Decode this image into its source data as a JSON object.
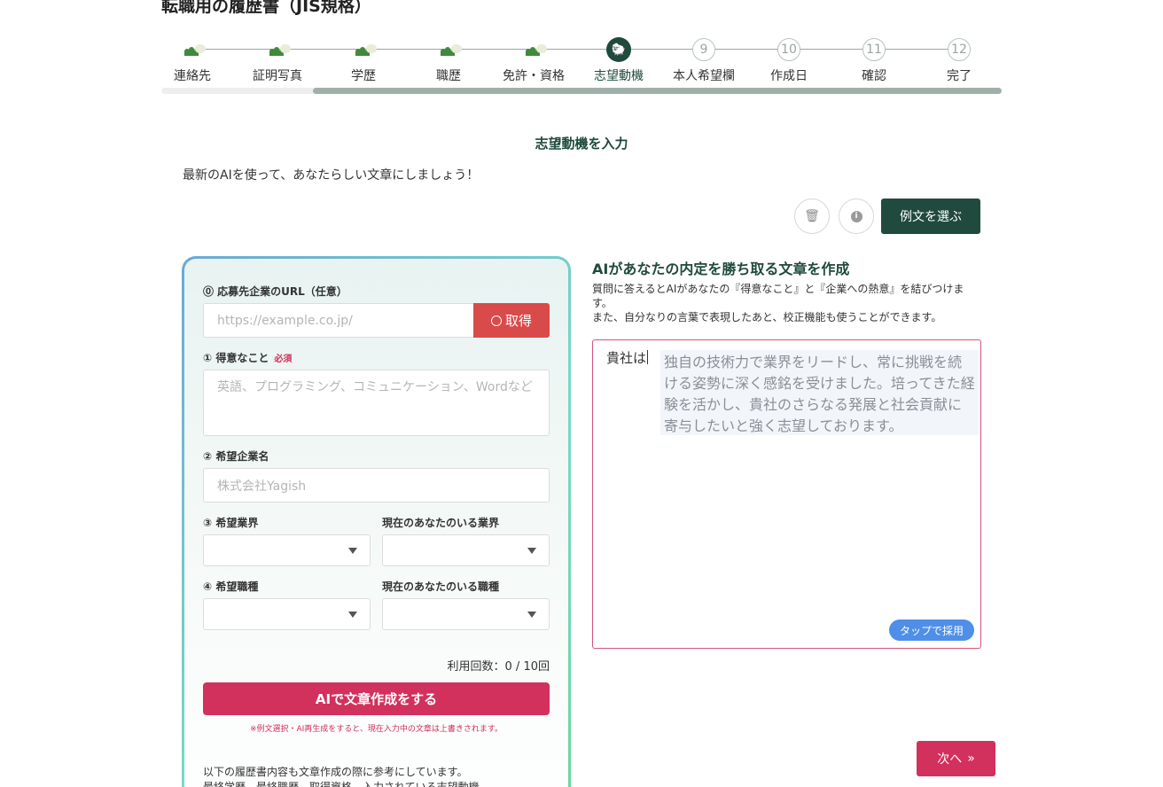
{
  "page": {
    "title": "転職用の履歴書（JIS規格）"
  },
  "stepper": {
    "progress_percent": 18,
    "steps": [
      {
        "label": "連絡先",
        "state": "done"
      },
      {
        "label": "証明写真",
        "state": "done"
      },
      {
        "label": "学歴",
        "state": "done"
      },
      {
        "label": "職歴",
        "state": "done"
      },
      {
        "label": "免許・資格",
        "state": "done"
      },
      {
        "label": "志望動機",
        "state": "active"
      },
      {
        "label": "本人希望欄",
        "state": "pending",
        "number": "9"
      },
      {
        "label": "作成日",
        "state": "pending",
        "number": "10"
      },
      {
        "label": "確認",
        "state": "pending",
        "number": "11"
      },
      {
        "label": "完了",
        "state": "pending",
        "number": "12"
      }
    ]
  },
  "section": {
    "heading": "志望動機を入力",
    "lead": "最新のAIを使って、あなたらしい文章にしましょう！"
  },
  "toolbar": {
    "example_label": "例文を選ぶ",
    "trash_icon": "trash-icon",
    "info_icon": "info-icon"
  },
  "form": {
    "url_label": "⓪ 応募先企業のURL（任意）",
    "url_placeholder": "https://example.co.jp/",
    "fetch_label": "取得",
    "strength_label": "① 得意なこと",
    "required_badge": "必須",
    "strength_placeholder": "英語、プログラミング、コミュニケーション、Wordなど",
    "company_label": "② 希望企業名",
    "company_placeholder": "株式会社Yagish",
    "industry_label": "③ 希望業界",
    "current_industry_label": "現在のあなたのいる業界",
    "job_label": "④ 希望職種",
    "current_job_label": "現在のあなたのいる職種",
    "usage": "利用回数：0 / 10回",
    "ai_button": "AIで文章作成をする",
    "warning": "※例文選択・AI再生成をすると、現在入力中の文章は上書きされます。",
    "ref_line1": "以下の履歴書内容も文章作成の際に参考にしています。",
    "ref_line2": "最終学歴、最終職歴、取得資格、入力されている志望動機"
  },
  "right": {
    "heading": "AIがあなたの内定を勝ち取る文章を作成",
    "desc1": "質問に答えるとAIがあなたの『得意なこと』と『企業への熱意』を結びつけます。",
    "desc2": "また、自分なりの言葉で表現したあと、校正機能も使うことができます。",
    "editor_prefix": "貴社は",
    "suggestion": "独自の技術力で業界をリードし、常に挑戦を続ける姿勢に深く感銘を受けました。培ってきた経験を活かし、貴社のさらなる発展と社会貢献に寄与したいと強く志望しております。",
    "tap_label": "タップで採用"
  },
  "footer": {
    "next_label": "次へ",
    "next_icon": "double-chevron-right-icon"
  }
}
